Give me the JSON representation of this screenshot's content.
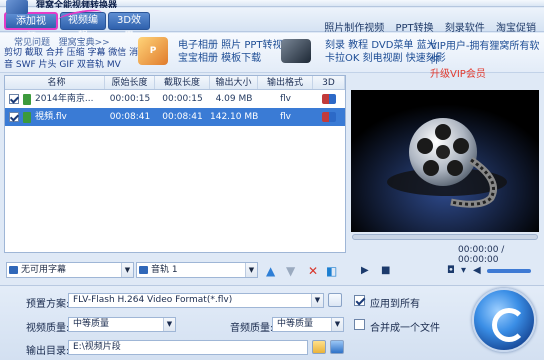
{
  "app": {
    "title": "狸窝全能视频转换器"
  },
  "toolbar": {
    "add_video": "添加视频",
    "edit_video": "视频编辑",
    "effect_3d": "3D效果",
    "links": [
      "照片制作视频",
      "PPT转换",
      "刻录软件",
      "淘宝促销"
    ]
  },
  "banner": {
    "faq": "常见问题",
    "tips": "狸窝宝典>>",
    "faq_links": "剪切 截取 合并 压缩 字幕 微信 消音 SWF 片头 GIF 双音轨 MV",
    "promo1_icon": "P",
    "promo1_line1": "电子相册 照片 PPT转视频",
    "promo1_line2": "宝宝相册 模板下载",
    "promo2_line1": "刻录 教程 DVD菜单 蓝光",
    "promo2_line2": "卡拉OK 刻电视剧 快速刻影",
    "vip_line1": "VIP用户-拥有狸窝所有软件",
    "vip_line2": "升级VIP会员"
  },
  "list": {
    "headers": [
      "名称",
      "原始长度",
      "截取长度",
      "输出大小",
      "输出格式",
      "3D"
    ],
    "rows": [
      {
        "name": "2014年南京...",
        "orig": "00:00:15",
        "cut": "00:00:15",
        "size": "4.09 MB",
        "fmt": "flv",
        "selected": false
      },
      {
        "name": "視頻.flv",
        "orig": "00:08:41",
        "cut": "00:08:41",
        "size": "142.10 MB",
        "fmt": "flv",
        "selected": true
      }
    ]
  },
  "list_tools": {
    "subtitle": "无可用字幕",
    "audio": "音轨 1"
  },
  "player": {
    "time": "00:00:00 / 00:00:00"
  },
  "settings": {
    "preset_label": "预置方案:",
    "preset_value": "FLV-Flash H.264 Video Format(*.flv)",
    "apply_all": "应用到所有",
    "video_quality_label": "视频质量:",
    "video_quality": "中等质量",
    "audio_quality_label": "音频质量:",
    "audio_quality": "中等质量",
    "merge_label": "合并成一个文件",
    "output_label": "输出目录:",
    "output_value": "E:\\视频片段"
  },
  "colors": {
    "accent": "#3a7bd5",
    "highlight": "#e33cc7",
    "vip_red": "#e23a2f"
  }
}
